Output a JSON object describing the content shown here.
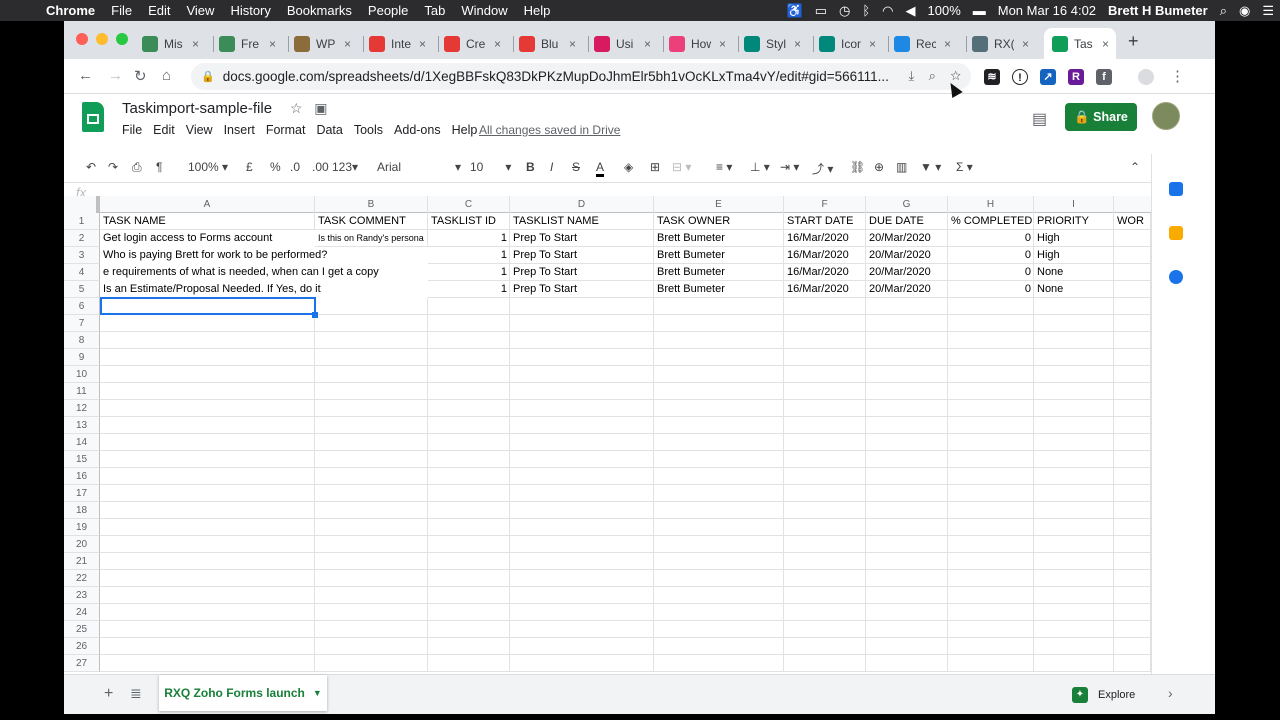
{
  "menubar": {
    "app": "Chrome",
    "items": [
      "File",
      "Edit",
      "View",
      "History",
      "Bookmarks",
      "People",
      "Tab",
      "Window",
      "Help"
    ],
    "battery": "100%",
    "datetime": "Mon Mar 16  4:02",
    "user": "Brett H Bumeter"
  },
  "browser": {
    "tabs": [
      {
        "label": "Mis",
        "color": "#3c8c5a"
      },
      {
        "label": "Fre",
        "color": "#3c8c5a"
      },
      {
        "label": "WP",
        "color": "#8a6d3b"
      },
      {
        "label": "Inte",
        "color": "#e53935"
      },
      {
        "label": "Cre",
        "color": "#e53935"
      },
      {
        "label": "Blu",
        "color": "#e53935"
      },
      {
        "label": "Usi",
        "color": "#d81b60"
      },
      {
        "label": "How",
        "color": "#ec407a"
      },
      {
        "label": "Styl",
        "color": "#00897b"
      },
      {
        "label": "Icon",
        "color": "#00897b"
      },
      {
        "label": "Rec",
        "color": "#1e88e5"
      },
      {
        "label": "RX(",
        "color": "#546e7a"
      },
      {
        "label": "Tas",
        "color": "#0f9d58"
      }
    ],
    "url": "docs.google.com/spreadsheets/d/1XegBBFskQ83DkPKzMupDoJhmElr5bh1vOcKLxTma4vY/edit#gid=566111..."
  },
  "doc": {
    "title": "Taskimport-sample-file",
    "menu": [
      "File",
      "Edit",
      "View",
      "Insert",
      "Format",
      "Data",
      "Tools",
      "Add-ons",
      "Help"
    ],
    "save_status": "All changes saved in Drive",
    "share_label": "Share"
  },
  "toolbar": {
    "zoom": "100%",
    "currency": "£",
    "percent": "%",
    "dec_less": ".0",
    "dec_more": ".00",
    "format_more": "123",
    "font": "Arial",
    "font_size": "10",
    "bold": "B",
    "italic": "I",
    "strike": "S",
    "text_color": "A",
    "fx": "fx"
  },
  "sheet": {
    "columns": [
      "A",
      "B",
      "C",
      "D",
      "E",
      "F",
      "G",
      "H",
      "I"
    ],
    "headers": [
      "TASK NAME",
      "TASK COMMENT",
      "TASKLIST ID",
      "TASKLIST NAME",
      "TASK OWNER",
      "START DATE",
      "DUE DATE",
      "% COMPLETED",
      "PRIORITY",
      "WOR"
    ],
    "rows": [
      [
        "Get login access to Forms account",
        "Is this on Randy's persona",
        "1",
        "Prep To Start",
        "Brett Bumeter",
        "16/Mar/2020",
        "20/Mar/2020",
        "0",
        "High"
      ],
      [
        "Who is paying Brett for work to be performed?",
        "",
        "1",
        "Prep To Start",
        "Brett Bumeter",
        "16/Mar/2020",
        "20/Mar/2020",
        "0",
        "High"
      ],
      [
        "e requirements of what is needed, when can I get a copy",
        "",
        "1",
        "Prep To Start",
        "Brett Bumeter",
        "16/Mar/2020",
        "20/Mar/2020",
        "0",
        "None"
      ],
      [
        "Is an Estimate/Proposal Needed. If Yes, do it",
        "",
        "1",
        "Prep To Start",
        "Brett Bumeter",
        "16/Mar/2020",
        "20/Mar/2020",
        "0",
        "None"
      ]
    ],
    "row_numbers": [
      "1",
      "2",
      "3",
      "4",
      "5",
      "6",
      "7",
      "8",
      "9",
      "10",
      "11",
      "12",
      "13",
      "14",
      "15",
      "16",
      "17",
      "18",
      "19",
      "20",
      "21",
      "22",
      "23",
      "24",
      "25",
      "26",
      "27"
    ]
  },
  "footer": {
    "sheet_tab": "RXQ Zoho Forms launch",
    "explore": "Explore"
  }
}
